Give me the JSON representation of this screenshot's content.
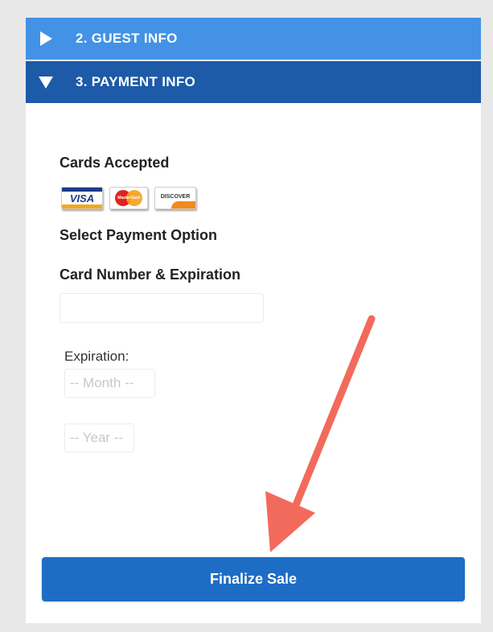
{
  "accordion": {
    "guest_label": "2. GUEST INFO",
    "payment_label": "3. PAYMENT INFO"
  },
  "payment": {
    "cards_heading": "Cards Accepted",
    "cards": [
      {
        "name": "VISA",
        "icon": "visa-card-icon"
      },
      {
        "name": "MasterCard",
        "icon": "mastercard-icon"
      },
      {
        "name": "DISCOVER",
        "icon": "discover-card-icon"
      }
    ],
    "select_option_heading": "Select Payment Option",
    "card_number_heading": "Card Number & Expiration",
    "card_number_value": "",
    "expiration_label": "Expiration:",
    "month_value": "-- Month --",
    "year_value": "-- Year --"
  },
  "finalize_label": "Finalize Sale",
  "colors": {
    "guest_header": "#4392e5",
    "payment_header": "#1d5aa8",
    "button": "#1e6dc5",
    "annotation_arrow": "#f26a5b"
  }
}
